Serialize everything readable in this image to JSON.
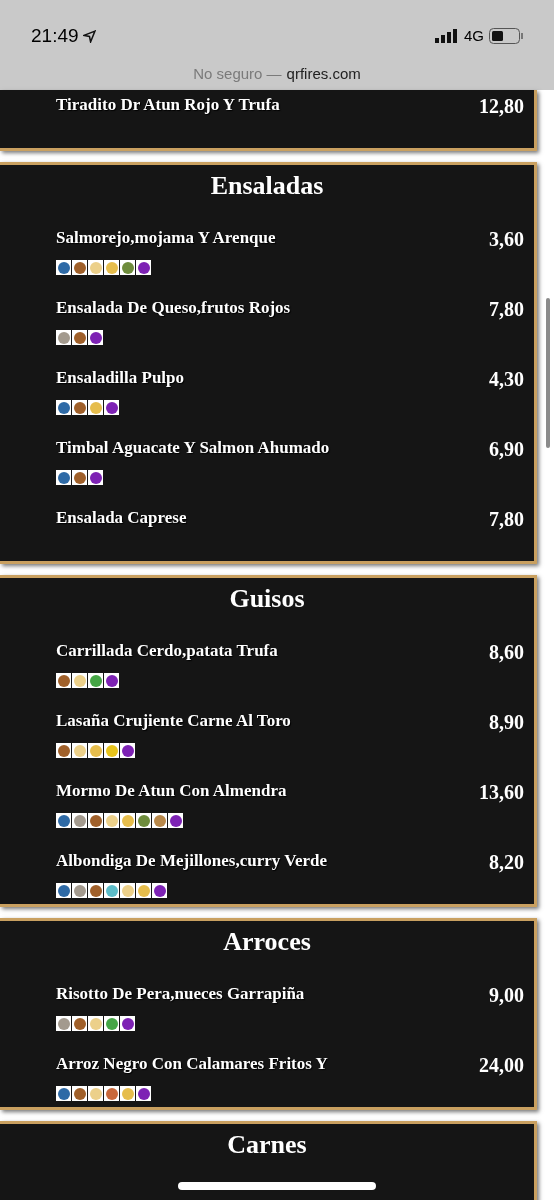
{
  "status_bar": {
    "time": "21:49",
    "network": "4G"
  },
  "address_bar": {
    "security": "No seguro —",
    "domain": "qrfires.com"
  },
  "sections": [
    {
      "items": [
        {
          "name": "Tiradito Dr Atun Rojo Y Trufa",
          "price": "12,80"
        }
      ]
    },
    {
      "title": "Ensaladas",
      "items": [
        {
          "name": "Salmorejo,mojama Y Arenque",
          "price": "3,60",
          "allergens": [
            {
              "color": "#2e6aa6"
            },
            {
              "color": "#a0602a"
            },
            {
              "color": "#ecd08a"
            },
            {
              "color": "#e6bd4c"
            },
            {
              "color": "#6e8c3c"
            },
            {
              "color": "#7d22b4"
            }
          ]
        },
        {
          "name": "Ensalada De Queso,frutos Rojos",
          "price": "7,80",
          "allergens": [
            {
              "color": "#a39a8e"
            },
            {
              "color": "#a0602a"
            },
            {
              "color": "#7d22b4"
            }
          ]
        },
        {
          "name": "Ensaladilla Pulpo",
          "price": "4,30",
          "allergens": [
            {
              "color": "#2e6aa6"
            },
            {
              "color": "#a0602a"
            },
            {
              "color": "#e6bd4c"
            },
            {
              "color": "#7d22b4"
            }
          ]
        },
        {
          "name": "Timbal Aguacate Y Salmon Ahumado",
          "price": "6,90",
          "allergens": [
            {
              "color": "#2e6aa6"
            },
            {
              "color": "#a0602a"
            },
            {
              "color": "#7d22b4"
            }
          ]
        },
        {
          "name": "Ensalada Caprese",
          "price": "7,80"
        }
      ]
    },
    {
      "title": "Guisos",
      "items": [
        {
          "name": "Carrillada Cerdo,patata Trufa",
          "price": "8,60",
          "allergens": [
            {
              "color": "#a0602a"
            },
            {
              "color": "#ecd08a"
            },
            {
              "color": "#45a645"
            },
            {
              "color": "#7d22b4"
            }
          ]
        },
        {
          "name": "Lasaña Crujiente Carne Al Toro",
          "price": "8,90",
          "allergens": [
            {
              "color": "#a0602a"
            },
            {
              "color": "#ecd08a"
            },
            {
              "color": "#e6bd4c"
            },
            {
              "color": "#e8c41c"
            },
            {
              "color": "#7d22b4"
            }
          ]
        },
        {
          "name": "Mormo De Atun Con Almendra",
          "price": "13,60",
          "allergens": [
            {
              "color": "#2e6aa6"
            },
            {
              "color": "#a39a8e"
            },
            {
              "color": "#a0602a"
            },
            {
              "color": "#ecd08a"
            },
            {
              "color": "#e6bd4c"
            },
            {
              "color": "#6e8c3c"
            },
            {
              "color": "#b8884a"
            },
            {
              "color": "#7d22b4"
            }
          ]
        },
        {
          "name": "Albondiga De Mejillones,curry Verde",
          "price": "8,20",
          "allergens": [
            {
              "color": "#2e6aa6"
            },
            {
              "color": "#a39a8e"
            },
            {
              "color": "#a0602a"
            },
            {
              "color": "#5cbcc8"
            },
            {
              "color": "#ecd08a"
            },
            {
              "color": "#e6bd4c"
            },
            {
              "color": "#7d22b4"
            }
          ]
        }
      ]
    },
    {
      "title": "Arroces",
      "items": [
        {
          "name": "Risotto De Pera,nueces Garrapiña",
          "price": "9,00",
          "allergens": [
            {
              "color": "#a39a8e"
            },
            {
              "color": "#a0602a"
            },
            {
              "color": "#ecd08a"
            },
            {
              "color": "#45a645"
            },
            {
              "color": "#7d22b4"
            }
          ]
        },
        {
          "name": "Arroz Negro Con Calamares Fritos Y",
          "price": "24,00",
          "allergens": [
            {
              "color": "#2e6aa6"
            },
            {
              "color": "#a0602a"
            },
            {
              "color": "#ecd08a"
            },
            {
              "color": "#c9683a"
            },
            {
              "color": "#e6bd4c"
            },
            {
              "color": "#7d22b4"
            }
          ]
        }
      ]
    },
    {
      "title": "Carnes"
    }
  ]
}
